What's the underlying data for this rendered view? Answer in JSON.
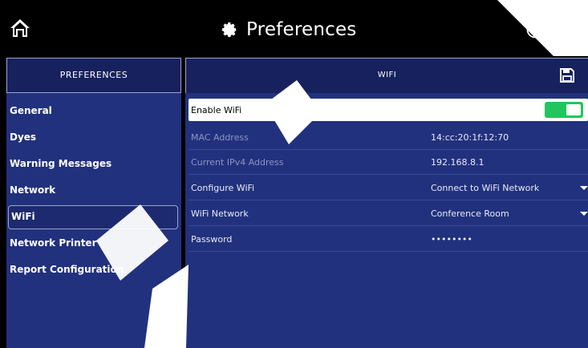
{
  "header": {
    "title": "Preferences",
    "icons": [
      "home-icon",
      "gear-icon",
      "info-icon",
      "battery-icon"
    ]
  },
  "sidebar": {
    "heading": "PREFERENCES",
    "items": [
      {
        "label": "General"
      },
      {
        "label": "Dyes"
      },
      {
        "label": "Warning Messages"
      },
      {
        "label": "Network"
      },
      {
        "label": "WiFi",
        "selected": true
      },
      {
        "label": "Network Printer"
      },
      {
        "label": "Report Configuration"
      }
    ]
  },
  "main": {
    "heading": "WIFI",
    "enable_wifi": {
      "label": "Enable WiFi",
      "on": true
    },
    "mac": {
      "label": "MAC Address",
      "value": "14:cc:20:1f:12:70"
    },
    "ipv4": {
      "label": "Current IPv4 Address",
      "value": "192.168.8.1"
    },
    "configure": {
      "label": "Configure WiFi",
      "value": "Connect to WiFi Network"
    },
    "network": {
      "label": "WiFi Network",
      "value": "Conference Room"
    },
    "password": {
      "label": "Password",
      "value": "••••••••"
    }
  },
  "colors": {
    "panel": "#22317d",
    "header_band": "#17215e",
    "toggle_on": "#22c55e"
  }
}
